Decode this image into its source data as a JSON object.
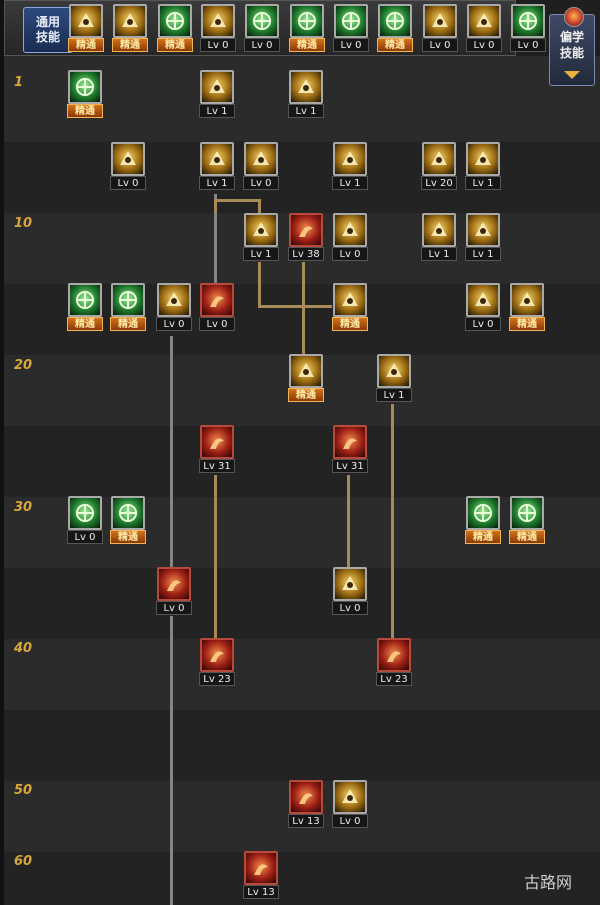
{
  "top_panel": {
    "common_label_line1": "通用",
    "common_label_line2": "技能",
    "skills": [
      {
        "tier": "gold",
        "icon": "pilot-icon",
        "label": "精通",
        "mastered": true
      },
      {
        "tier": "gold",
        "icon": "arrow-swoosh-icon",
        "label": "精通",
        "mastered": true
      },
      {
        "tier": "green",
        "icon": "kick-icon",
        "label": "精通",
        "mastered": true
      },
      {
        "tier": "gold",
        "icon": "wings-icon",
        "label": "Lv 0",
        "mastered": false
      },
      {
        "tier": "green",
        "icon": "crosshair-icon",
        "label": "Lv 0",
        "mastered": false
      },
      {
        "tier": "green",
        "icon": "crosshair-icon",
        "label": "精通",
        "mastered": true
      },
      {
        "tier": "green",
        "icon": "fighter-icon",
        "label": "Lv 0",
        "mastered": false
      },
      {
        "tier": "green",
        "icon": "mushroom-icon",
        "label": "精通",
        "mastered": true
      },
      {
        "tier": "gold",
        "icon": "spiral-icon",
        "label": "Lv 0",
        "mastered": false
      },
      {
        "tier": "gold",
        "icon": "meditate-icon",
        "label": "Lv 0",
        "mastered": false
      },
      {
        "tier": "green",
        "icon": "spirit-icon",
        "label": "Lv 0",
        "mastered": false
      }
    ]
  },
  "other_skills_button": {
    "line1": "偏学",
    "line2": "技能"
  },
  "level_markers": [
    "1",
    "10",
    "20",
    "30",
    "40",
    "50",
    "60"
  ],
  "skills": [
    {
      "tier": "green",
      "icon": "robot-icon",
      "label": "精通",
      "mastered": true
    },
    {
      "tier": "gold",
      "icon": "dash-icon",
      "label": "Lv 1",
      "mastered": false
    },
    {
      "tier": "gold",
      "icon": "fist-icon",
      "label": "Lv 1",
      "mastered": false
    },
    {
      "tier": "gold",
      "icon": "hook-icon",
      "label": "Lv 0",
      "mastered": false
    },
    {
      "tier": "gold",
      "icon": "shoot-icon",
      "label": "Lv 1",
      "mastered": false
    },
    {
      "tier": "gold",
      "icon": "sparks-icon",
      "label": "Lv 0",
      "mastered": false
    },
    {
      "tier": "gold",
      "icon": "emblem-icon",
      "label": "Lv 1",
      "mastered": false
    },
    {
      "tier": "gold",
      "icon": "box-icon",
      "label": "Lv 20",
      "mastered": false
    },
    {
      "tier": "gold",
      "icon": "knot-icon",
      "label": "Lv 1",
      "mastered": false
    },
    {
      "tier": "gold",
      "icon": "strike-icon",
      "label": "Lv 1",
      "mastered": false
    },
    {
      "tier": "red",
      "icon": "flame-strike-icon",
      "label": "Lv 38",
      "mastered": false
    },
    {
      "tier": "gold",
      "icon": "whip-icon",
      "label": "Lv 0",
      "mastered": false
    },
    {
      "tier": "gold",
      "icon": "grenade-icon",
      "label": "Lv 1",
      "mastered": false
    },
    {
      "tier": "gold",
      "icon": "burst-icon",
      "label": "Lv 1",
      "mastered": false
    },
    {
      "tier": "green",
      "icon": "head-icon",
      "label": "精通",
      "mastered": true
    },
    {
      "tier": "green",
      "icon": "runner-icon",
      "label": "精通",
      "mastered": true
    },
    {
      "tier": "gold",
      "icon": "armor-icon",
      "label": "Lv 0",
      "mastered": false
    },
    {
      "tier": "red",
      "icon": "claw-icon",
      "label": "Lv 0",
      "mastered": false
    },
    {
      "tier": "gold",
      "icon": "jump-icon",
      "label": "精通",
      "mastered": true
    },
    {
      "tier": "gold",
      "icon": "explosion-icon",
      "label": "Lv 0",
      "mastered": false
    },
    {
      "tier": "gold",
      "icon": "fire-icon",
      "label": "精通",
      "mastered": true
    },
    {
      "tier": "gold",
      "icon": "stars-icon",
      "label": "精通",
      "mastered": true
    },
    {
      "tier": "gold",
      "icon": "ring-icon",
      "label": "Lv 1",
      "mastered": false
    },
    {
      "tier": "red",
      "icon": "pillar-icon",
      "label": "Lv 31",
      "mastered": false
    },
    {
      "tier": "red",
      "icon": "wave-icon",
      "label": "Lv 31",
      "mastered": false
    },
    {
      "tier": "green",
      "icon": "aura-icon",
      "label": "Lv 0",
      "mastered": false
    },
    {
      "tier": "green",
      "icon": "crosshair-icon",
      "label": "精通",
      "mastered": true
    },
    {
      "tier": "green",
      "icon": "aura-icon",
      "label": "精通",
      "mastered": true
    },
    {
      "tier": "green",
      "icon": "crosshair-icon",
      "label": "精通",
      "mastered": true
    },
    {
      "tier": "red",
      "icon": "vortex-icon",
      "label": "Lv 0",
      "mastered": false
    },
    {
      "tier": "gold",
      "icon": "flame-icon",
      "label": "Lv 0",
      "mastered": false
    },
    {
      "tier": "red",
      "icon": "beast-icon",
      "label": "Lv 23",
      "mastered": false
    },
    {
      "tier": "red",
      "icon": "cyclone-icon",
      "label": "Lv 23",
      "mastered": false
    },
    {
      "tier": "red",
      "icon": "drop-icon",
      "label": "Lv 13",
      "mastered": false
    },
    {
      "tier": "gold",
      "icon": "crystal-icon",
      "label": "Lv 0",
      "mastered": false
    },
    {
      "tier": "red",
      "icon": "cannon-icon",
      "label": "Lv 13",
      "mastered": false
    }
  ],
  "watermark": "古路网"
}
